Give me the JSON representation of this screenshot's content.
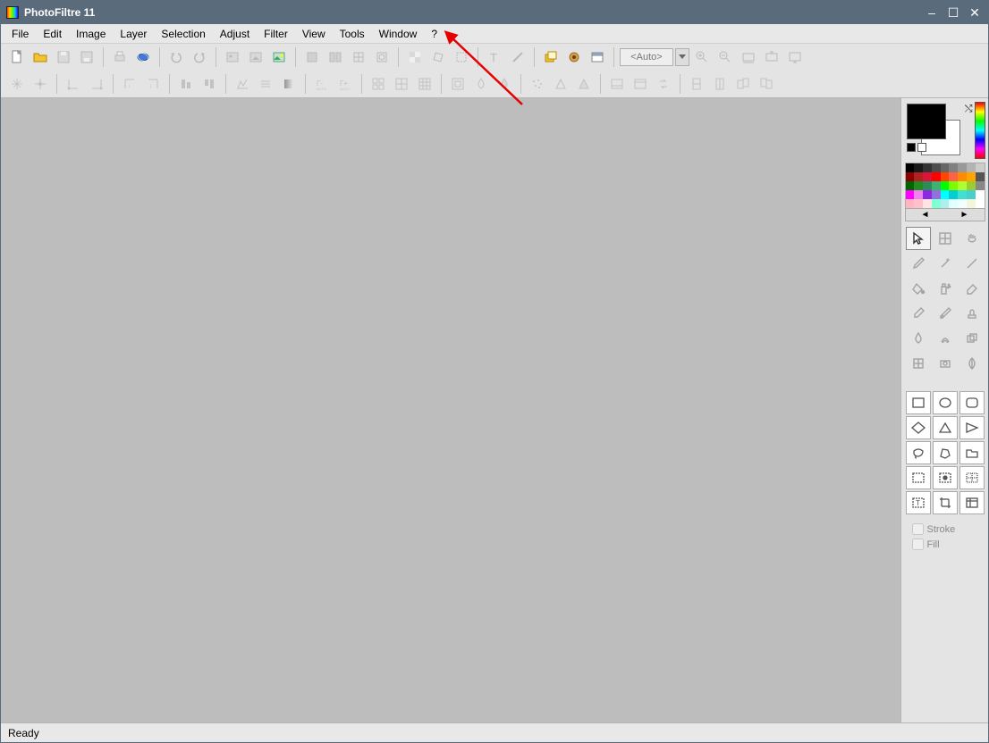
{
  "app": {
    "title": "PhotoFiltre 11"
  },
  "menu": {
    "items": [
      "File",
      "Edit",
      "Image",
      "Layer",
      "Selection",
      "Adjust",
      "Filter",
      "View",
      "Tools",
      "Window",
      "?"
    ]
  },
  "toolbar": {
    "auto_label": "<Auto>"
  },
  "status": {
    "text": "Ready"
  },
  "right": {
    "stroke_label": "Stroke",
    "fill_label": "Fill"
  },
  "colors": {
    "foreground": "#000000",
    "background": "#ffffff",
    "palette": [
      [
        "#000000",
        "#1a1a1a",
        "#333333",
        "#4d4d4d",
        "#666666",
        "#808080",
        "#999999",
        "#b3b3b3",
        "#cccccc"
      ],
      [
        "#8b0000",
        "#b22222",
        "#dc143c",
        "#ff0000",
        "#ff4500",
        "#ff6347",
        "#ff8c00",
        "#ffa500",
        "#555555"
      ],
      [
        "#006400",
        "#228b22",
        "#2e8b57",
        "#3cb371",
        "#00ff00",
        "#7cfc00",
        "#adff2f",
        "#9acd32",
        "#888888"
      ],
      [
        "#ff00ff",
        "#ee82ee",
        "#8a2be2",
        "#9370db",
        "#00ffff",
        "#00ced1",
        "#40e0d0",
        "#48d1cc",
        "#ffffff"
      ],
      [
        "#ffb6c1",
        "#ffc0cb",
        "#ffe4e1",
        "#7fffd4",
        "#afeeee",
        "#e0ffff",
        "#f0ffff",
        "#f5f5dc",
        "#ffffff"
      ]
    ]
  },
  "icons": {
    "new": "new",
    "open": "open",
    "save": "save",
    "save2": "save2",
    "print": "print",
    "twain": "twain",
    "undo": "undo",
    "redo": "redo",
    "img1": "image-mode",
    "img2": "image-resize",
    "img3": "image-explore",
    "grey1": "grey",
    "grey2": "grey",
    "grey3": "grey",
    "grey4": "grey",
    "trans1": "transparency",
    "trans2": "rotate",
    "sel": "selection",
    "text": "text",
    "brush": "brush",
    "layers": "layers",
    "plugin": "plugin",
    "window": "window",
    "zin": "zoom-in",
    "zout": "zoom-out",
    "fit1": "fit",
    "fit2": "fit",
    "screen": "screen",
    "r2_1": "sparkle",
    "r2_2": "sparkle",
    "r2_3": "angle",
    "r2_4": "angle",
    "r2_5": "corner",
    "r2_6": "corner",
    "r2_7": "align",
    "r2_8": "align",
    "r2_9": "levels",
    "r2_10": "lines",
    "r2_11": "gradient",
    "r2_12": "gamma",
    "r2_13": "gamma",
    "r2_14": "grid",
    "r2_15": "grid",
    "r2_16": "grid",
    "r2_17": "frame",
    "r2_18": "drop",
    "r2_19": "drop",
    "r2_20": "dust",
    "r2_21": "tri",
    "r2_22": "tri",
    "r2_23": "panel",
    "r2_24": "panel",
    "r2_25": "swap",
    "r2_26": "page",
    "r2_27": "page",
    "r2_28": "pages",
    "r2_29": "pages"
  },
  "tools": {
    "items": [
      "pointer",
      "grid",
      "hand",
      "picker",
      "wand",
      "line",
      "fill",
      "spray",
      "eraser",
      "brush",
      "pencil",
      "stamp",
      "blur",
      "smudge",
      "clone",
      "distort",
      "shape",
      "leaf"
    ]
  },
  "shapes": {
    "items": [
      "rect",
      "ellipse",
      "roundrect",
      "diamond",
      "triangle",
      "right-tri",
      "lasso",
      "poly",
      "folder",
      "marquee1",
      "marquee2",
      "marquee3",
      "marquee4",
      "crop",
      "grid"
    ]
  }
}
